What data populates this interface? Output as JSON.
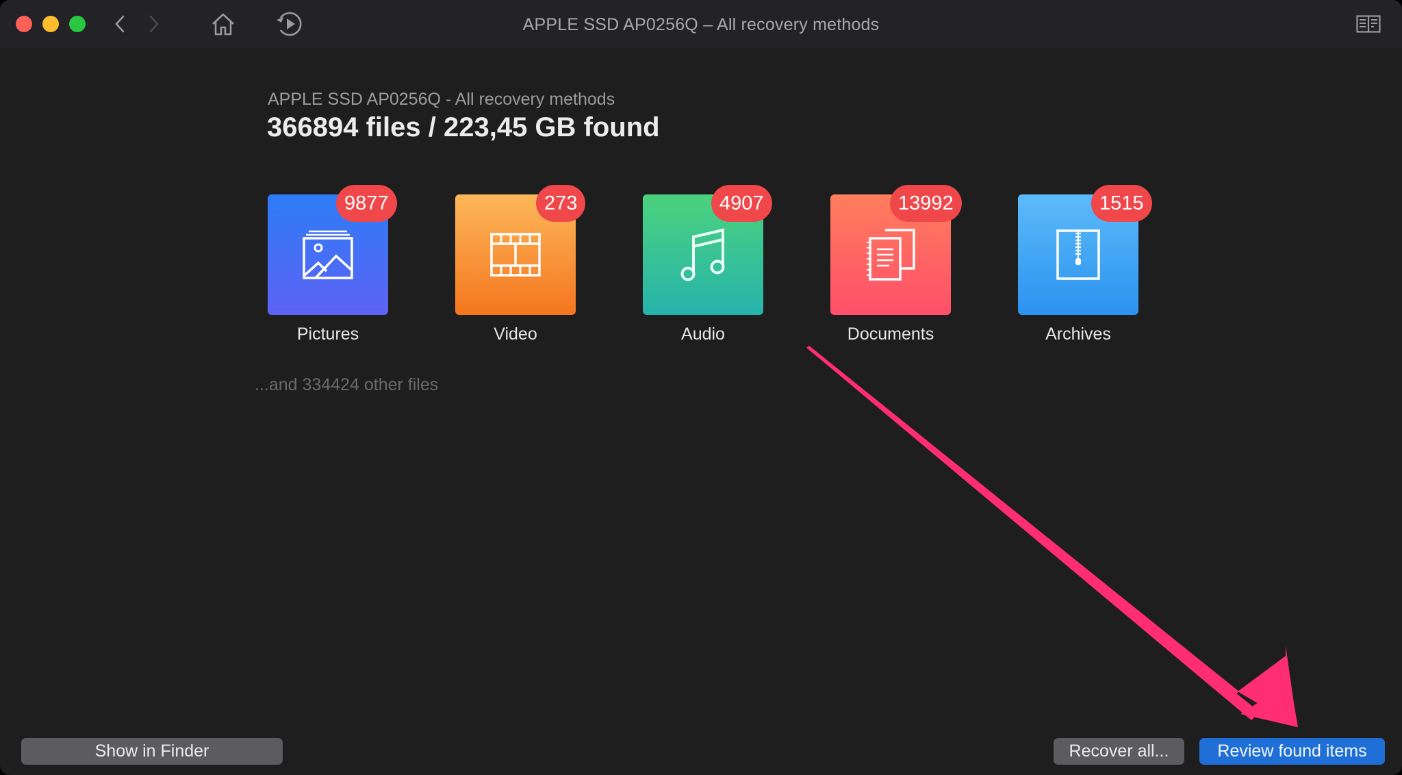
{
  "window": {
    "title": "APPLE SSD AP0256Q – All recovery methods",
    "toolbar_icons": [
      "back-icon",
      "forward-icon",
      "home-icon",
      "resume-session-icon",
      "reader-view-icon"
    ]
  },
  "header": {
    "subtitle": "APPLE SSD AP0256Q - All recovery methods",
    "headline": "366894 files / 223,45 GB found"
  },
  "categories": [
    {
      "label": "Pictures",
      "count": "9877",
      "icon": "picture-icon",
      "gradient": [
        "#2e7cf6",
        "#5d62f5"
      ]
    },
    {
      "label": "Video",
      "count": "273",
      "icon": "film-icon",
      "gradient": [
        "#fdb75a",
        "#f4761e"
      ]
    },
    {
      "label": "Audio",
      "count": "4907",
      "icon": "music-note-icon",
      "gradient": [
        "#4bd27c",
        "#27b3ad"
      ]
    },
    {
      "label": "Documents",
      "count": "13992",
      "icon": "documents-icon",
      "gradient": [
        "#ff7e5c",
        "#ff4f6a"
      ]
    },
    {
      "label": "Archives",
      "count": "1515",
      "icon": "zip-archive-icon",
      "gradient": [
        "#5cbbf9",
        "#2b92ef"
      ]
    }
  ],
  "other_files": "...and 334424 other files",
  "footer": {
    "show_in_finder": "Show in Finder",
    "recover_all": "Recover all...",
    "review_found_items": "Review found items"
  },
  "colors": {
    "badge": "#f0474a",
    "primary_button": "#1f6fd6",
    "annotation_arrow": "#ff2d73"
  }
}
